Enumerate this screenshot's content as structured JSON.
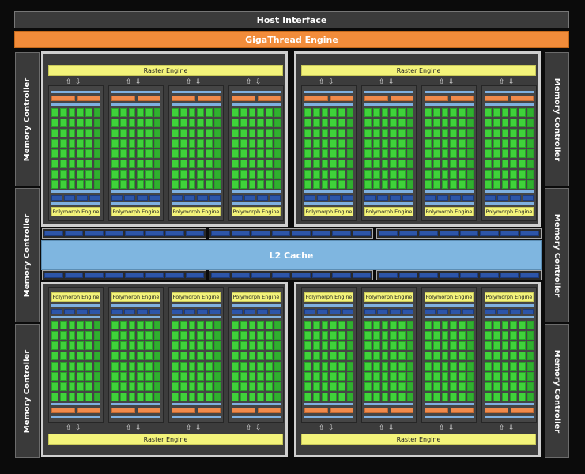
{
  "host_interface": "Host Interface",
  "gigathread_engine": "GigaThread Engine",
  "l2_cache": "L2 Cache",
  "memory_controller_label": "Memory Controller",
  "raster_engine_label": "Raster Engine",
  "polymorph_engine_label": "Polymorph Engine",
  "gpc_count": 4,
  "sms_per_gpc": 4,
  "memory_controllers_per_side": 3,
  "colors": {
    "background": "#0b0b0b",
    "gigathread": "#f28c3a",
    "raster": "#f3f37a",
    "l2": "#7fb6e0",
    "core": "#3fd23a",
    "unit_blue": "#2d55a8",
    "scheduler_orange": "#f08a4b"
  }
}
